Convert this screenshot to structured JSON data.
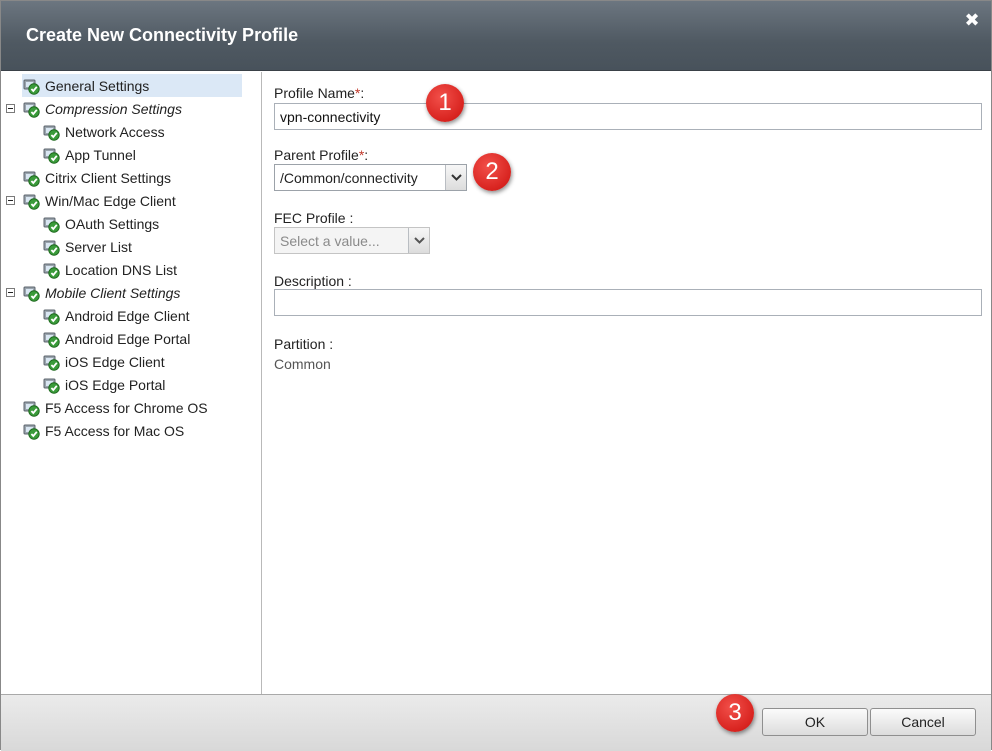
{
  "dialog": {
    "title": "Create New Connectivity Profile",
    "close_glyph": "✖"
  },
  "nav": {
    "items": [
      {
        "label": "General Settings",
        "italic": false,
        "level": 0,
        "expander": false,
        "selected": true
      },
      {
        "label": "Compression Settings",
        "italic": true,
        "level": 0,
        "expander": true,
        "selected": false
      },
      {
        "label": "Network Access",
        "italic": false,
        "level": 1,
        "expander": false,
        "selected": false
      },
      {
        "label": "App Tunnel",
        "italic": false,
        "level": 1,
        "expander": false,
        "selected": false
      },
      {
        "label": "Citrix Client Settings",
        "italic": false,
        "level": 0,
        "expander": false,
        "selected": false
      },
      {
        "label": "Win/Mac Edge Client",
        "italic": false,
        "level": 0,
        "expander": true,
        "selected": false
      },
      {
        "label": "OAuth Settings",
        "italic": false,
        "level": 1,
        "expander": false,
        "selected": false
      },
      {
        "label": "Server List",
        "italic": false,
        "level": 1,
        "expander": false,
        "selected": false
      },
      {
        "label": "Location DNS List",
        "italic": false,
        "level": 1,
        "expander": false,
        "selected": false
      },
      {
        "label": "Mobile Client Settings",
        "italic": true,
        "level": 0,
        "expander": true,
        "selected": false
      },
      {
        "label": "Android Edge Client",
        "italic": false,
        "level": 1,
        "expander": false,
        "selected": false
      },
      {
        "label": "Android Edge Portal",
        "italic": false,
        "level": 1,
        "expander": false,
        "selected": false
      },
      {
        "label": "iOS Edge Client",
        "italic": false,
        "level": 1,
        "expander": false,
        "selected": false
      },
      {
        "label": "iOS Edge Portal",
        "italic": false,
        "level": 1,
        "expander": false,
        "selected": false
      },
      {
        "label": "F5 Access for Chrome OS",
        "italic": false,
        "level": 0,
        "expander": false,
        "selected": false
      },
      {
        "label": "F5 Access for Mac OS",
        "italic": false,
        "level": 0,
        "expander": false,
        "selected": false
      }
    ]
  },
  "form": {
    "profile_name": {
      "label": "Profile Name",
      "required_mark": "*",
      "suffix": ":",
      "value": "vpn-connectivity"
    },
    "parent_profile": {
      "label": "Parent Profile",
      "required_mark": "*",
      "suffix": ":",
      "value": "/Common/connectivity"
    },
    "fec_profile": {
      "label": "FEC Profile",
      "suffix": ":",
      "placeholder": "Select a value..."
    },
    "description": {
      "label": "Description",
      "suffix": ":",
      "value": ""
    },
    "partition": {
      "label": "Partition",
      "suffix": ":",
      "value": "Common"
    }
  },
  "footer": {
    "ok_label": "OK",
    "cancel_label": "Cancel"
  },
  "annotations": [
    "1",
    "2",
    "3"
  ],
  "colors": {
    "titlebar": "#58626b",
    "selected_row": "#dbe8f6",
    "required": "#c0392b",
    "badge": "#d8231f"
  }
}
